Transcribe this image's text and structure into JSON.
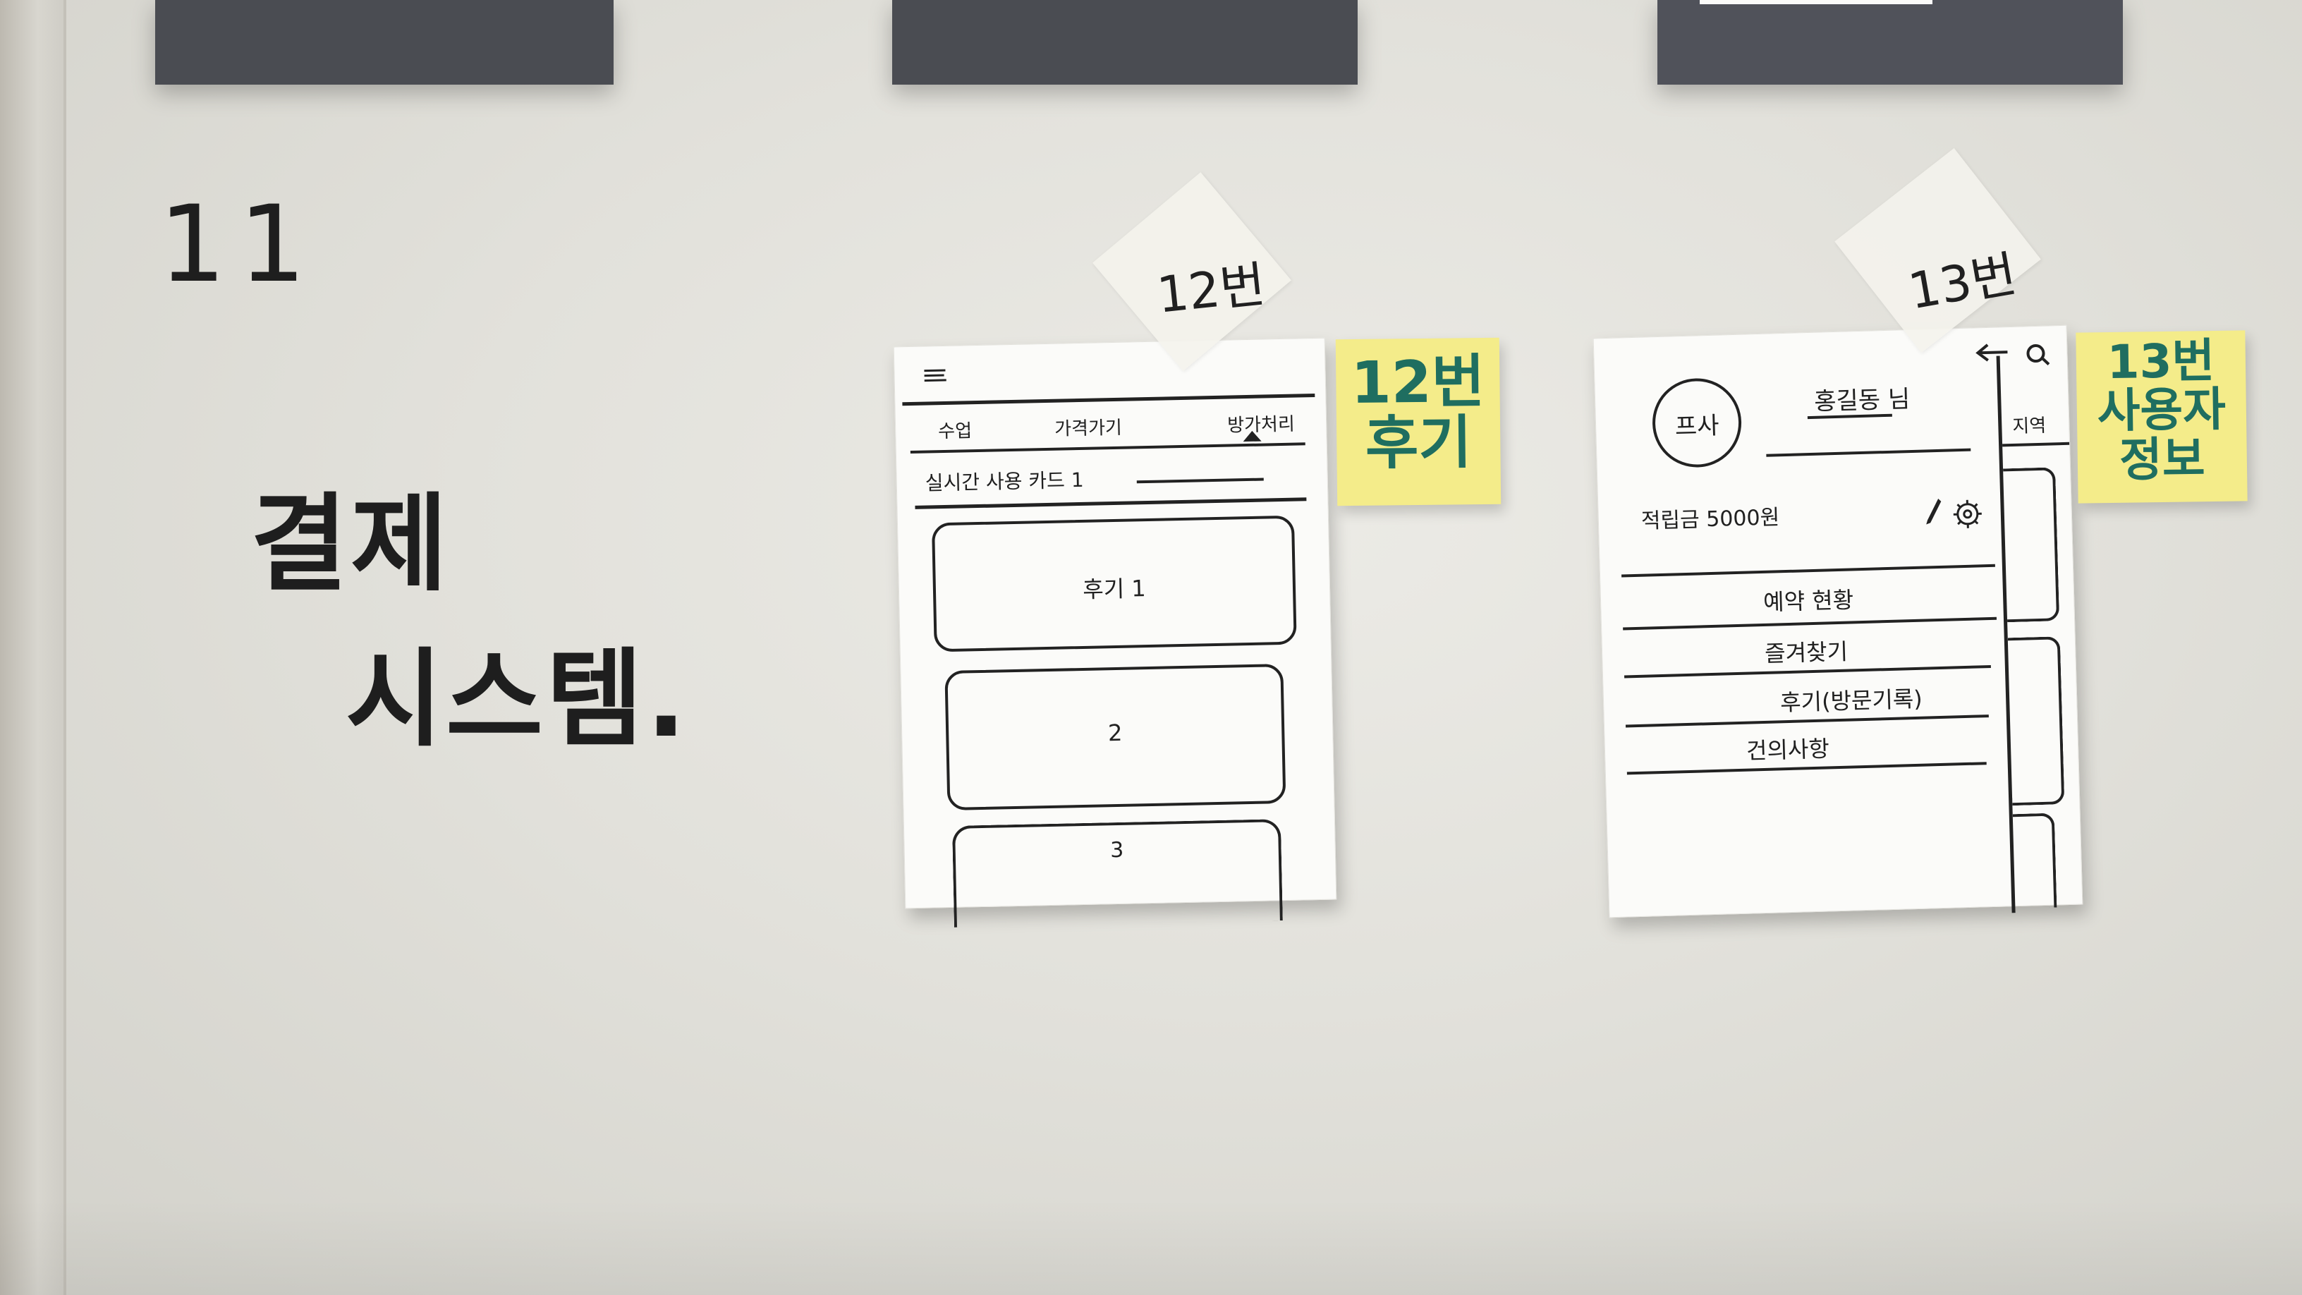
{
  "whiteboard": {
    "number": "11",
    "title_line1": "결제",
    "title_line2": "시스템."
  },
  "tape_labels": {
    "sheet12": "12번",
    "sheet13": "13번"
  },
  "sheet12": {
    "menu_icon": "hamburger-menu-icon",
    "tabs": [
      "수업",
      "가격가기",
      "방가처리"
    ],
    "subheader": "실시간 사용 카드 1",
    "cards": [
      "후기 1",
      "2",
      "3"
    ]
  },
  "sticky12": {
    "line1": "12번",
    "line2": "후기"
  },
  "sheet13": {
    "back_icon": "back-arrow-icon",
    "search_icon": "search-icon",
    "side_tab": "지역",
    "avatar": "프사",
    "username": "홍길동 님",
    "points": "적립금 5000원",
    "edit_icon": "pencil-icon",
    "settings_icon": "gear-icon",
    "menu": [
      "예약 현황",
      "즐겨찾기",
      "후기(방문기록)",
      "건의사항"
    ]
  },
  "sticky13": {
    "line1": "13번",
    "line2": "사용자",
    "line3": "정보"
  }
}
